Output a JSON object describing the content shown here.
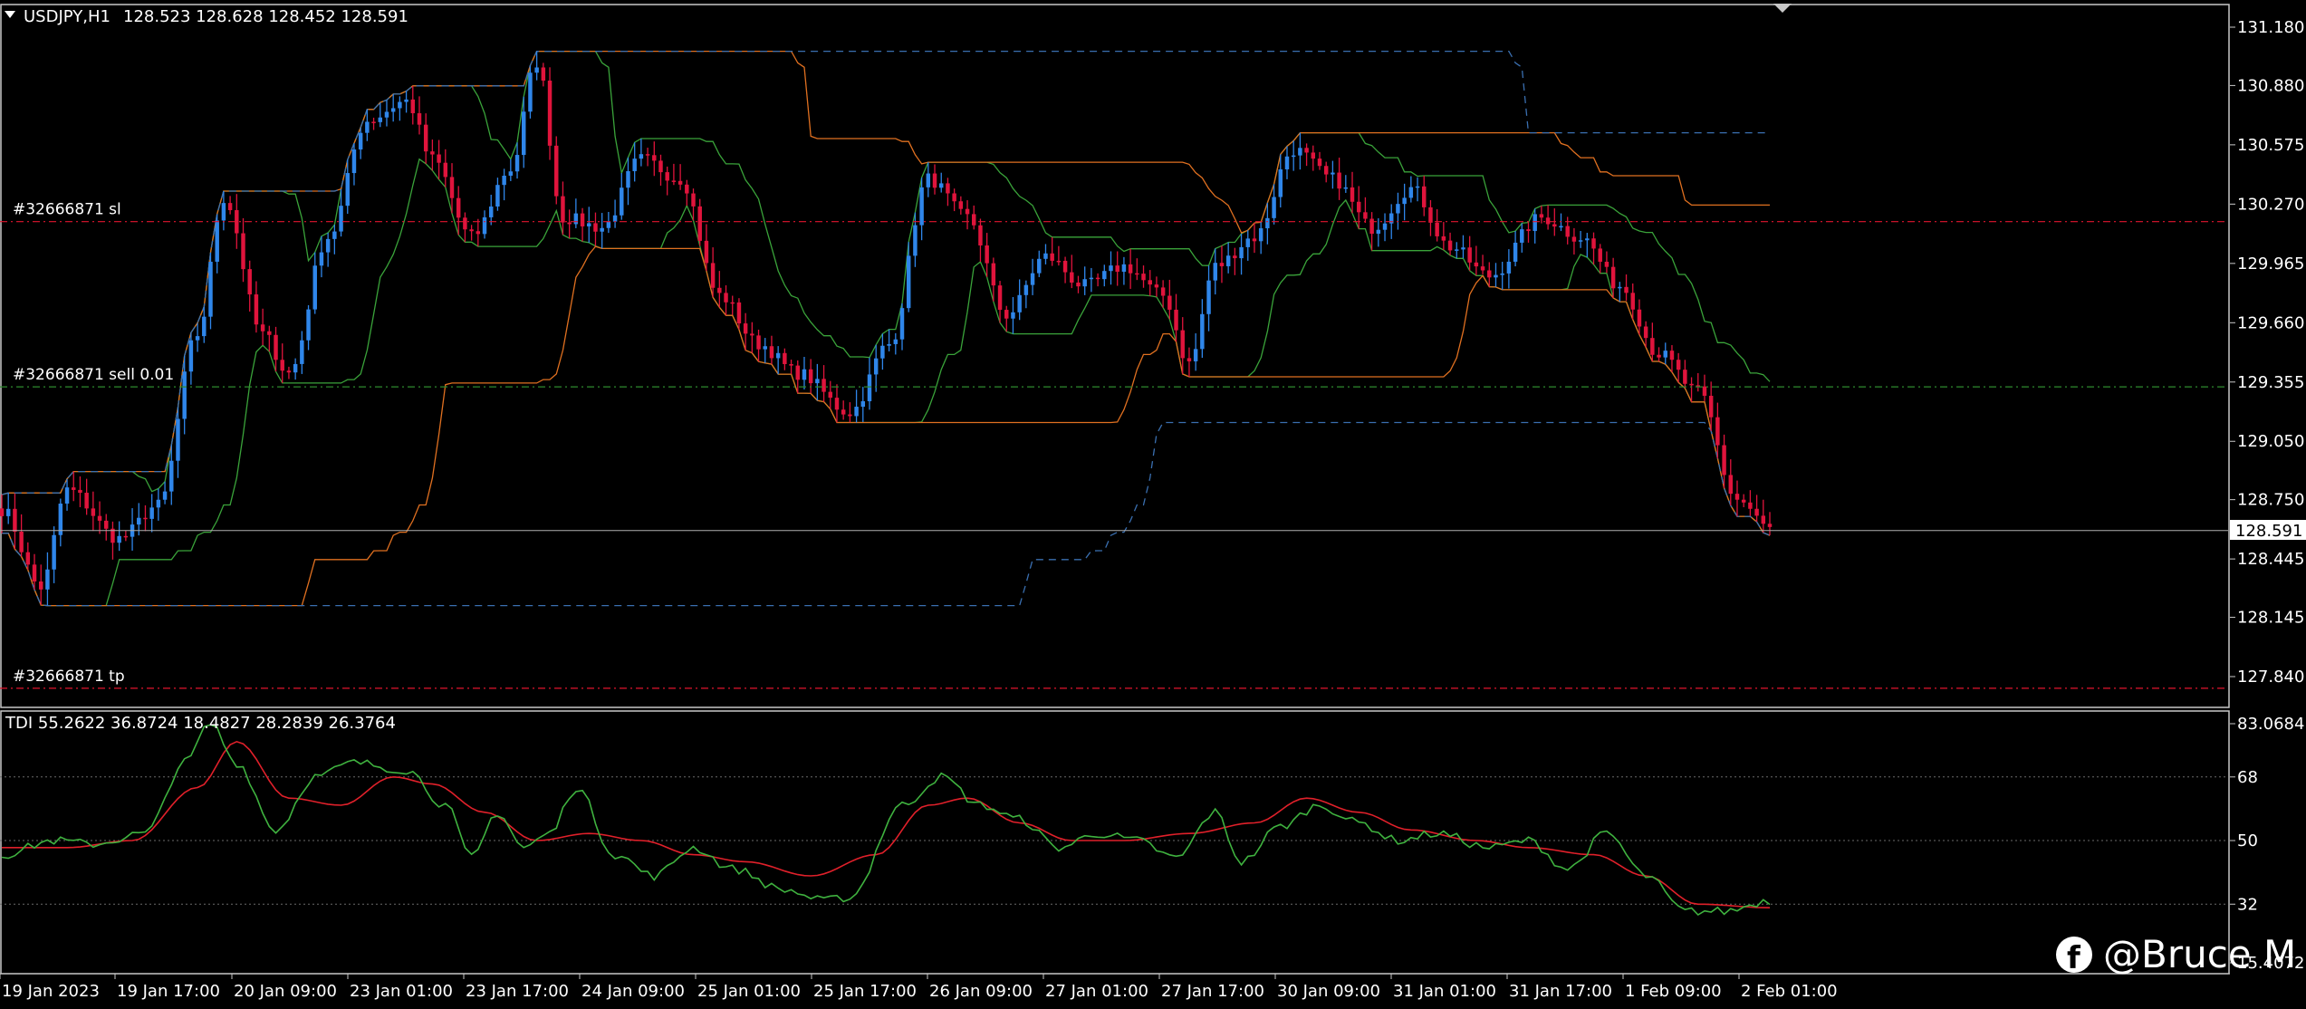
{
  "main_chart": {
    "title": "USDJPY,H1",
    "ohlc": "128.523 128.628 128.452 128.591",
    "current_price": "128.591",
    "price_labels": [
      "131.180",
      "130.880",
      "130.575",
      "130.270",
      "129.965",
      "129.660",
      "129.355",
      "129.050",
      "128.750",
      "128.445",
      "128.145",
      "127.840"
    ],
    "order_lines": [
      {
        "label": "#32666871 sl",
        "price": 130.18,
        "color": "#e0142e"
      },
      {
        "label": "#32666871 sell 0.01",
        "price": 129.33,
        "color": "#2e8b2e"
      },
      {
        "label": "#32666871 tp",
        "price": 127.78,
        "color": "#e0142e"
      }
    ]
  },
  "indicator": {
    "title": "TDI 55.2622 36.8724 18.4827 28.2839 26.3764",
    "labels": [
      "83.0684",
      "68",
      "50",
      "32",
      "15.4072"
    ]
  },
  "time_labels": [
    "19 Jan 2023",
    "19 Jan 17:00",
    "20 Jan 09:00",
    "23 Jan 01:00",
    "23 Jan 17:00",
    "24 Jan 09:00",
    "25 Jan 01:00",
    "25 Jan 17:00",
    "26 Jan 09:00",
    "27 Jan 01:00",
    "27 Jan 17:00",
    "30 Jan 09:00",
    "31 Jan 01:00",
    "31 Jan 17:00",
    "1 Feb 09:00",
    "2 Feb 01:00"
  ],
  "watermark": {
    "icon": "facebook-icon",
    "text": "@Bruce M"
  },
  "colors": {
    "bull": "#2f86ea",
    "bear": "#e0143c",
    "upper_band": "#3aa33a",
    "orange_line": "#e07020",
    "dashed_line": "#3a6fb0",
    "tdi_fast": "#3fb23f",
    "tdi_slow": "#e0202a"
  },
  "chart_data": {
    "type": "candlestick",
    "symbol": "USDJPY",
    "timeframe": "H1",
    "x_start": "19 Jan 2023",
    "x_end": "2 Feb 01:00",
    "ylim": [
      127.7,
      131.25
    ],
    "keypoints_close": [
      [
        0,
        128.7
      ],
      [
        6,
        128.3
      ],
      [
        10,
        128.8
      ],
      [
        18,
        128.55
      ],
      [
        24,
        128.72
      ],
      [
        30,
        129.6
      ],
      [
        34,
        130.3
      ],
      [
        40,
        129.6
      ],
      [
        44,
        129.4
      ],
      [
        50,
        130.1
      ],
      [
        56,
        130.7
      ],
      [
        62,
        130.8
      ],
      [
        66,
        130.5
      ],
      [
        72,
        130.1
      ],
      [
        78,
        130.45
      ],
      [
        82,
        131.0
      ],
      [
        86,
        130.2
      ],
      [
        92,
        130.15
      ],
      [
        98,
        130.5
      ],
      [
        104,
        130.4
      ],
      [
        110,
        129.8
      ],
      [
        116,
        129.55
      ],
      [
        122,
        129.4
      ],
      [
        130,
        129.2
      ],
      [
        136,
        129.55
      ],
      [
        142,
        130.4
      ],
      [
        148,
        130.2
      ],
      [
        154,
        129.7
      ],
      [
        160,
        130.0
      ],
      [
        166,
        129.85
      ],
      [
        172,
        129.95
      ],
      [
        178,
        129.8
      ],
      [
        182,
        129.45
      ],
      [
        186,
        129.95
      ],
      [
        192,
        130.1
      ],
      [
        198,
        130.55
      ],
      [
        204,
        130.4
      ],
      [
        210,
        130.15
      ],
      [
        216,
        130.35
      ],
      [
        222,
        130.05
      ],
      [
        228,
        129.9
      ],
      [
        236,
        130.2
      ],
      [
        242,
        130.1
      ],
      [
        248,
        129.85
      ],
      [
        254,
        129.5
      ],
      [
        260,
        129.3
      ],
      [
        266,
        128.75
      ],
      [
        271,
        128.6
      ]
    ],
    "tdi": {
      "fast_keypoints": [
        [
          0,
          46
        ],
        [
          8,
          50
        ],
        [
          14,
          49
        ],
        [
          22,
          52
        ],
        [
          28,
          72
        ],
        [
          32,
          83
        ],
        [
          36,
          72
        ],
        [
          42,
          53
        ],
        [
          48,
          68
        ],
        [
          54,
          72
        ],
        [
          62,
          70
        ],
        [
          68,
          60
        ],
        [
          72,
          45
        ],
        [
          76,
          58
        ],
        [
          80,
          48
        ],
        [
          84,
          52
        ],
        [
          88,
          65
        ],
        [
          94,
          46
        ],
        [
          100,
          40
        ],
        [
          106,
          48
        ],
        [
          112,
          42
        ],
        [
          120,
          36
        ],
        [
          126,
          33
        ],
        [
          130,
          34
        ],
        [
          138,
          60
        ],
        [
          144,
          68
        ],
        [
          150,
          60
        ],
        [
          156,
          56
        ],
        [
          162,
          48
        ],
        [
          168,
          52
        ],
        [
          174,
          50
        ],
        [
          180,
          45
        ],
        [
          186,
          58
        ],
        [
          190,
          44
        ],
        [
          196,
          54
        ],
        [
          202,
          60
        ],
        [
          208,
          55
        ],
        [
          214,
          50
        ],
        [
          220,
          52
        ],
        [
          228,
          48
        ],
        [
          234,
          50
        ],
        [
          240,
          42
        ],
        [
          246,
          52
        ],
        [
          252,
          40
        ],
        [
          258,
          30
        ],
        [
          264,
          30
        ],
        [
          271,
          33
        ]
      ],
      "slow_keypoints": [
        [
          0,
          48
        ],
        [
          10,
          48
        ],
        [
          20,
          50
        ],
        [
          30,
          65
        ],
        [
          36,
          78
        ],
        [
          44,
          62
        ],
        [
          52,
          60
        ],
        [
          60,
          68
        ],
        [
          66,
          66
        ],
        [
          74,
          58
        ],
        [
          82,
          50
        ],
        [
          90,
          52
        ],
        [
          98,
          50
        ],
        [
          106,
          46
        ],
        [
          114,
          44
        ],
        [
          124,
          40
        ],
        [
          134,
          46
        ],
        [
          142,
          60
        ],
        [
          148,
          62
        ],
        [
          156,
          55
        ],
        [
          164,
          50
        ],
        [
          172,
          50
        ],
        [
          182,
          52
        ],
        [
          192,
          55
        ],
        [
          200,
          62
        ],
        [
          208,
          58
        ],
        [
          216,
          53
        ],
        [
          226,
          50
        ],
        [
          234,
          48
        ],
        [
          244,
          46
        ],
        [
          252,
          40
        ],
        [
          260,
          32
        ],
        [
          271,
          31
        ]
      ],
      "levels": [
        68,
        50,
        32
      ],
      "ylim": [
        15.4072,
        83.0684
      ]
    }
  }
}
